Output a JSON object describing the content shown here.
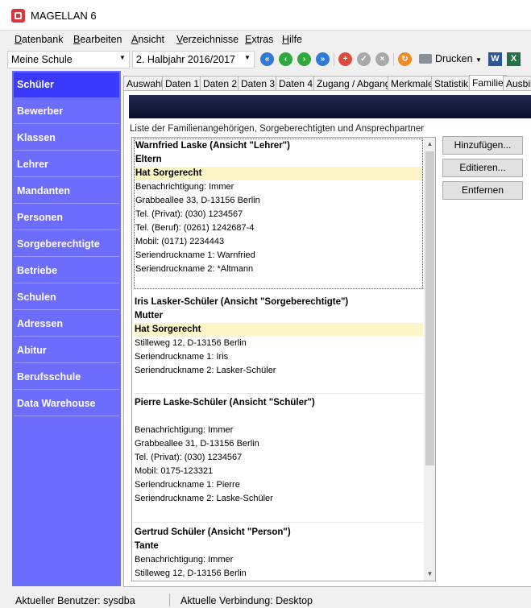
{
  "window": {
    "title": "MAGELLAN 6"
  },
  "menu": [
    {
      "ul": "D",
      "rest": "atenbank"
    },
    {
      "ul": "B",
      "rest": "earbeiten"
    },
    {
      "ul": "A",
      "rest": "nsicht"
    },
    {
      "ul": "V",
      "rest": "erzeichnisse"
    },
    {
      "ul": "E",
      "rest": "xtras"
    },
    {
      "ul": "H",
      "rest": "ilfe"
    }
  ],
  "toolbar": {
    "school": "Meine Schule",
    "term": "2. Halbjahr 2016/2017",
    "print_label": "Drucken",
    "colors": {
      "nav": "#2f79d8",
      "go": "#2faa3a",
      "add": "#e0483a",
      "disabled": "#a9a9a9",
      "refresh": "#f08a24"
    }
  },
  "sidebar": {
    "accent": "#6c6cff",
    "active_color": "#3a3aff",
    "items": [
      "Schüler",
      "Bewerber",
      "Klassen",
      "Lehrer",
      "Mandanten",
      "Personen",
      "Sorgeberechtigte",
      "Betriebe",
      "Schulen",
      "Adressen",
      "Abitur",
      "Berufsschule",
      "Data Warehouse"
    ]
  },
  "tabs": [
    "Auswahl",
    "Daten 1",
    "Daten 2",
    "Daten 3",
    "Daten 4",
    "Zugang / Abgang",
    "Merkmale",
    "Statistik",
    "Familie",
    "Ausbild"
  ],
  "active_tab": "Familie",
  "family": {
    "section_label": "Liste der Familienangehörigen, Sorgeberechtigten und Ansprechpartner",
    "members": [
      {
        "name": "Warnfried Laske (Ansicht \"Lehrer\")",
        "relation": "Eltern",
        "custody": "Hat Sorgerecht",
        "details": [
          "Benachrichtigung: Immer",
          "Grabbeallee 33, D-13156 Berlin",
          "Tel. (Privat): (030) 1234567",
          "Tel. (Beruf): (0261) 1242687-4",
          "Mobil: (0171) 2234443",
          "Seriendruckname 1: Warnfried",
          "Seriendruckname 2: *Altmann"
        ]
      },
      {
        "name": "Iris Lasker-Schüler (Ansicht \"Sorgeberechtigte\")",
        "relation": "Mutter",
        "custody": "Hat Sorgerecht",
        "details": [
          "Stilleweg 12, D-13156 Berlin",
          "Seriendruckname 1: Iris",
          "Seriendruckname 2: Lasker-Schüler"
        ]
      },
      {
        "name": "Pierre Laske-Schüler (Ansicht \"Schüler\")",
        "details": [
          "Benachrichtigung: Immer",
          "Grabbeallee 31, D-13156 Berlin",
          "Tel. (Privat): (030) 1234567",
          "Mobil: 0175-123321",
          "Seriendruckname 1: Pierre",
          "Seriendruckname 2: Laske-Schüler"
        ]
      },
      {
        "name": "Gertrud Schüler (Ansicht \"Person\")",
        "relation": "Tante",
        "details": [
          "Benachrichtigung: Immer",
          "Stilleweg 12, D-13156 Berlin"
        ]
      }
    ],
    "buttons": {
      "add": "Hinzufügen...",
      "edit": "Editieren...",
      "remove": "Entfernen"
    },
    "highlight_color": "#fdf7c8"
  },
  "status": {
    "user": "Aktueller Benutzer: sysdba",
    "connection": "Aktuelle Verbindung: Desktop"
  }
}
